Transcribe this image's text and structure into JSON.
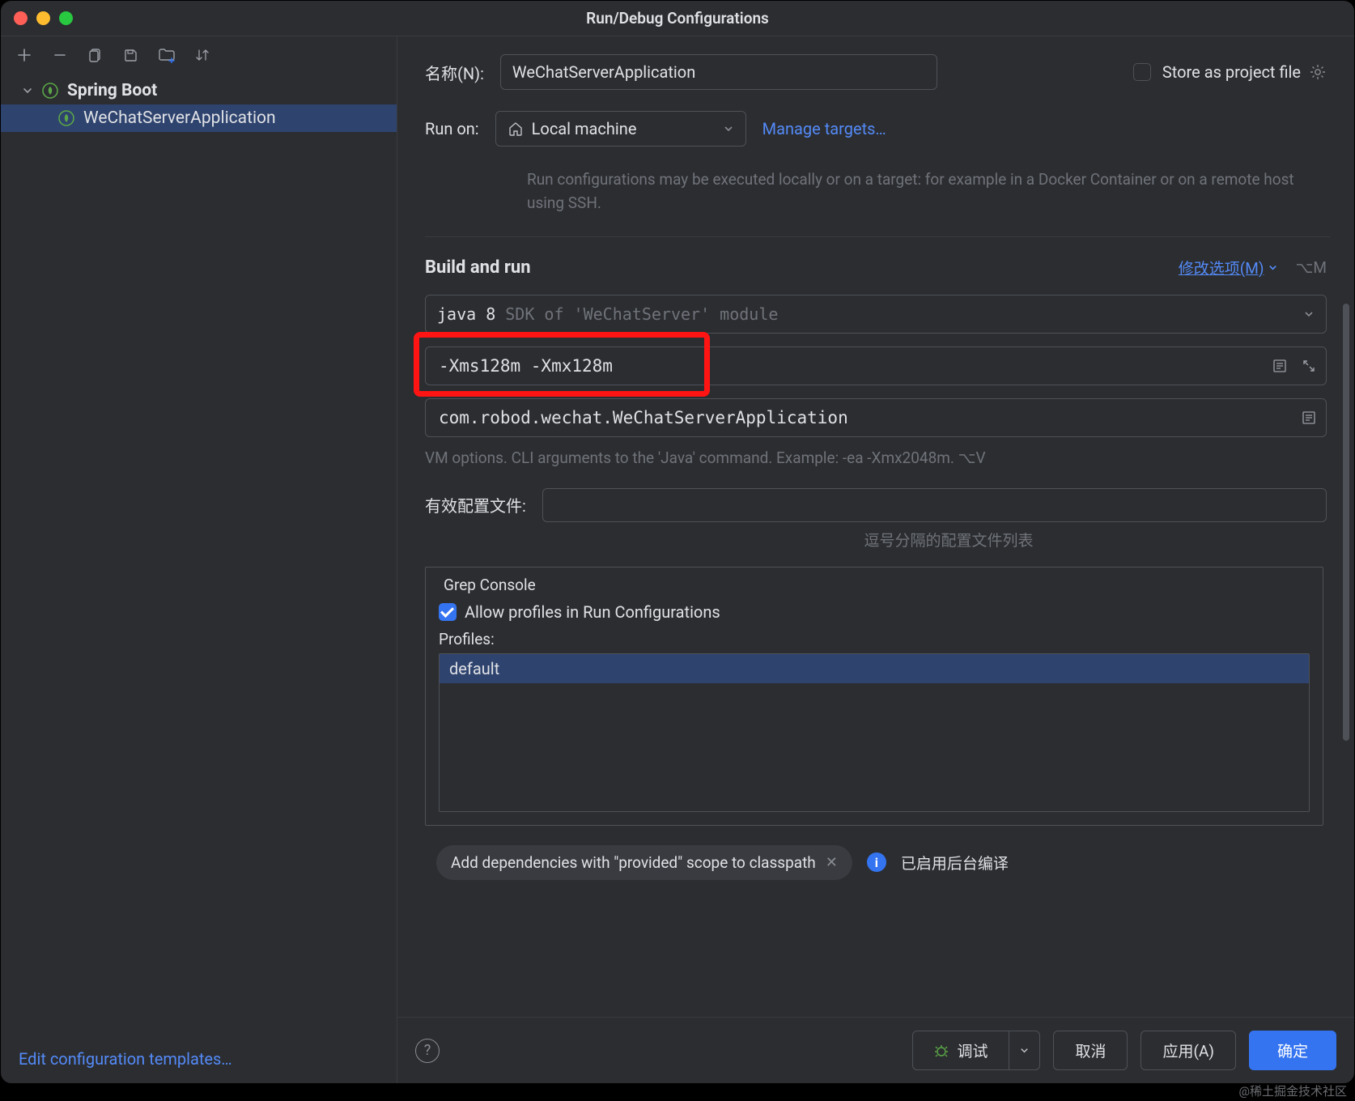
{
  "window": {
    "title": "Run/Debug Configurations"
  },
  "toolbar": {
    "icons": [
      "add",
      "remove",
      "copy",
      "save",
      "folder-add",
      "sort"
    ]
  },
  "tree": {
    "group": "Spring Boot",
    "item": "WeChatServerApplication"
  },
  "sidebar_footer": {
    "templates_link": "Edit configuration templates…"
  },
  "form": {
    "name_label": "名称(N):",
    "name_value": "WeChatServerApplication",
    "store_as_project": "Store as project file",
    "run_on_label": "Run on:",
    "run_on_value": "Local machine",
    "manage_targets": "Manage targets…",
    "run_on_hint": "Run configurations may be executed locally or on a target: for example in a Docker Container or on a remote host using SSH."
  },
  "build": {
    "section_title": "Build and run",
    "modify_label": "修改选项(M)",
    "modify_shortcut": "⌥M",
    "sdk_label": "java 8",
    "sdk_hint": "SDK of 'WeChatServer' module",
    "vm_options": "-Xms128m -Xmx128m",
    "main_class": "com.robod.wechat.WeChatServerApplication",
    "vm_hint": "VM options. CLI arguments to the 'Java' command. Example: -ea -Xmx2048m. ⌥V",
    "profiles_label": "有效配置文件:",
    "profiles_hint": "逗号分隔的配置文件列表"
  },
  "grep": {
    "legend": "Grep Console",
    "allow_label": "Allow profiles in Run Configurations",
    "profiles_label": "Profiles:",
    "profiles": [
      "default"
    ]
  },
  "chips": {
    "provided": "Add dependencies with \"provided\" scope to classpath",
    "info_text": "已启用后台编译"
  },
  "footer": {
    "debug": "调试",
    "cancel": "取消",
    "apply": "应用(A)",
    "ok": "确定"
  },
  "watermark": "@稀土掘金技术社区"
}
